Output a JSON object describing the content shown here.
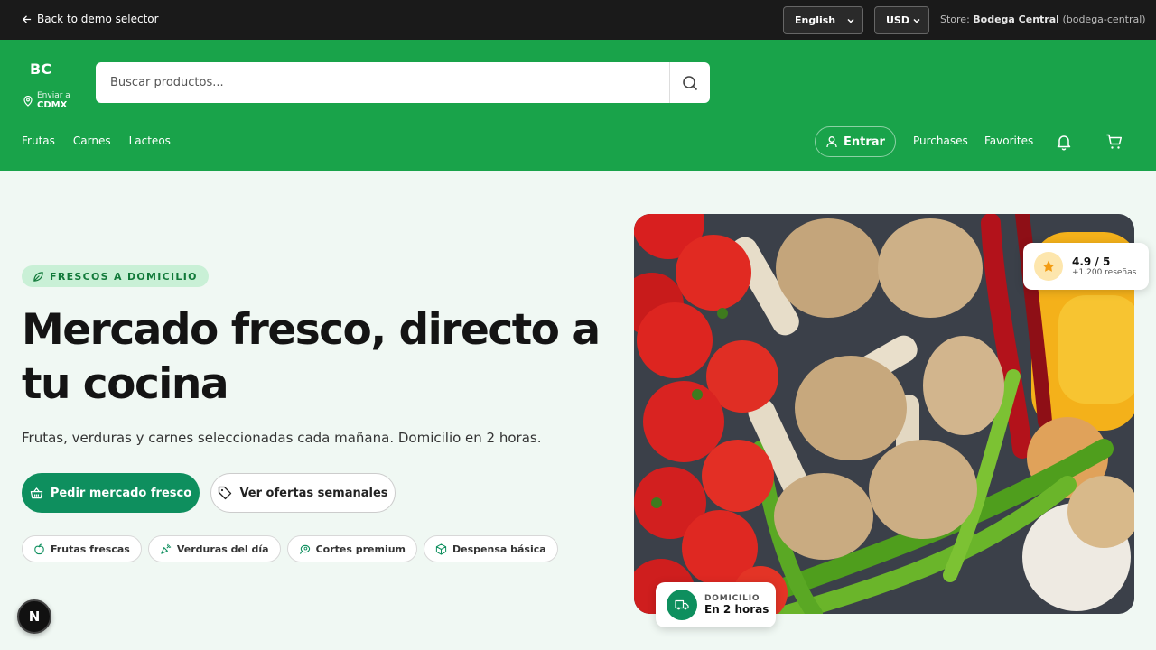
{
  "topbar": {
    "back_label": "Back to demo selector",
    "language": "English",
    "currency": "USD",
    "store_prefix": "Store:",
    "store_name": "Bodega Central",
    "store_id": "(bodega-central)"
  },
  "header": {
    "logo": "BC",
    "deliver_label": "Enviar a",
    "deliver_location": "CDMX",
    "search_placeholder": "Buscar productos...",
    "categories": [
      "Frutas",
      "Carnes",
      "Lacteos"
    ],
    "login_label": "Entrar",
    "purchases_label": "Purchases",
    "favorites_label": "Favorites"
  },
  "hero": {
    "badge": "FRESCOS A DOMICILIO",
    "title": "Mercado fresco, directo a tu cocina",
    "subtitle": "Frutas, verduras y carnes seleccionadas cada mañana. Domicilio en 2 horas.",
    "primary_cta": "Pedir mercado fresco",
    "secondary_cta": "Ver ofertas semanales",
    "chips": [
      "Frutas frescas",
      "Verduras del día",
      "Cortes premium",
      "Despensa básica"
    ]
  },
  "rating": {
    "score": "4.9 / 5",
    "reviews": "+1.200 reseñas"
  },
  "delivery": {
    "label": "DOMICILIO",
    "time": "En 2 horas"
  },
  "dev_badge": "N",
  "colors": {
    "header_green": "#19a34a",
    "primary_green": "#0e8f5e",
    "topbar": "#1a1a1a",
    "background": "#f0f8f3"
  }
}
